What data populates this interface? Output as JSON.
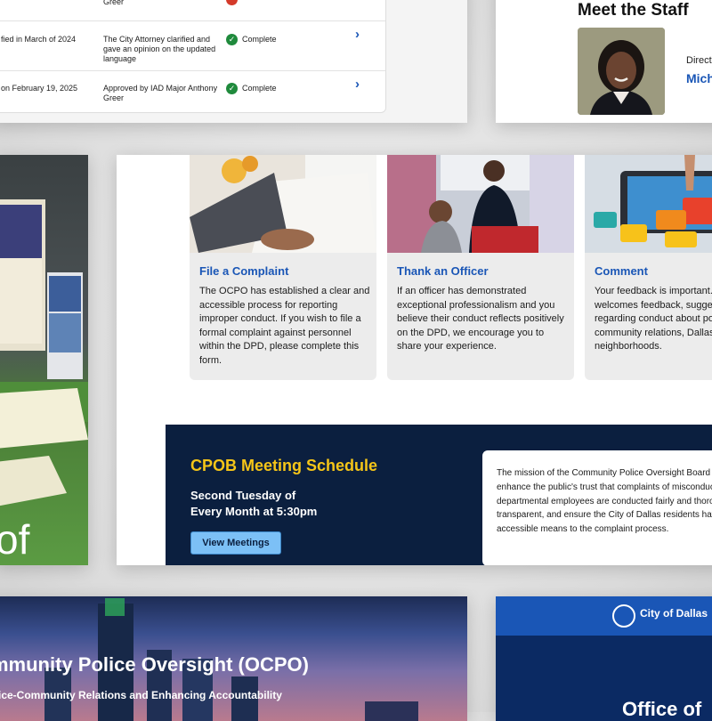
{
  "status_table": {
    "rows": [
      {
        "event": "",
        "detail": "Greer",
        "status": "",
        "status_icon": "alert-icon"
      },
      {
        "event": "fied in March of 2024",
        "detail": "The City Attorney clarified and gave an opinion on the updated language",
        "status": "Complete",
        "status_icon": "check-icon"
      },
      {
        "event": "on February 19, 2025",
        "detail": "Approved by IAD Major Anthony Greer",
        "status": "Complete",
        "status_icon": "check-icon"
      }
    ]
  },
  "staff": {
    "title": "Meet the Staff",
    "role": "Direct",
    "name": "Mich"
  },
  "features": [
    {
      "title": "File a Complaint",
      "body": "The OCPO has established a clear and accessible process for reporting improper conduct. If you wish to file a formal complaint against personnel within the DPD, please complete this form.",
      "image_icon": "laptop-photo"
    },
    {
      "title": "Thank an Officer",
      "body": "If an officer has demonstrated exceptional professionalism and you believe their conduct reflects positively on the DPD, we encourage you to share your experience.",
      "image_icon": "officer-photo"
    },
    {
      "title": "Comment",
      "body": "Your feedback is important. OCPO welcomes feedback, suggestions regarding conduct about police-community relations, Dallas neighborhoods.",
      "image_icon": "speech-bubbles-photo"
    }
  ],
  "cpob": {
    "title": "CPOB Meeting Schedule",
    "time_line1": "Second Tuesday of",
    "time_line2": "Every Month at 5:30pm",
    "button": "View Meetings",
    "mission": "The mission of the Community Police Oversight Board (CPOB) is to enhance the public's trust that complaints of misconduct against departmental employees are conducted fairly and thoroughly, are transparent, and ensure the City of Dallas residents have an accessible means to the complaint process."
  },
  "hero": {
    "title": "mmunity Police Oversight (OCPO)",
    "subtitle": "ice-Community Relations and Enhancing Accountability"
  },
  "dallas": {
    "name": "City of Dallas",
    "office": "Office of"
  },
  "booth": {
    "visible_text": "of"
  },
  "colors": {
    "link_blue": "#1a56b6",
    "navy": "#0b1f3f",
    "gold": "#f5c518",
    "button_blue": "#7cc0f6",
    "success_green": "#1f8a3c"
  }
}
